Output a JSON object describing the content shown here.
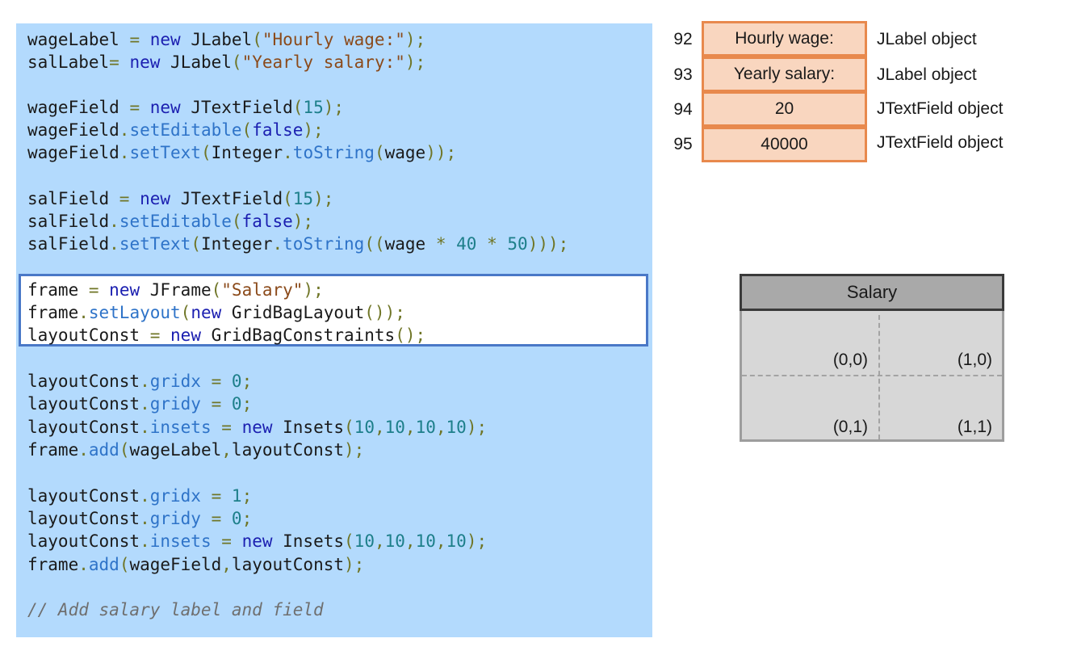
{
  "code": {
    "comment": "// Add salary label and field"
  },
  "memory": {
    "rows": [
      {
        "addr": "92",
        "value": "Hourly wage:",
        "type": "JLabel object"
      },
      {
        "addr": "93",
        "value": "Yearly salary:",
        "type": "JLabel object"
      },
      {
        "addr": "94",
        "value": "20",
        "type": "JTextField object"
      },
      {
        "addr": "95",
        "value": "40000",
        "type": "JTextField object"
      }
    ]
  },
  "frame_preview": {
    "title": "Salary",
    "cells": [
      "(0,0)",
      "(1,0)",
      "(0,1)",
      "(1,1)"
    ]
  },
  "colors": {
    "code_bg": "#b3dafd",
    "highlight_border": "#4a78c7",
    "memory_border": "#e8894d",
    "memory_fill": "#f9d6bf",
    "frame_bg": "#d7d7d7",
    "frame_title_bg": "#a9a9a9"
  }
}
